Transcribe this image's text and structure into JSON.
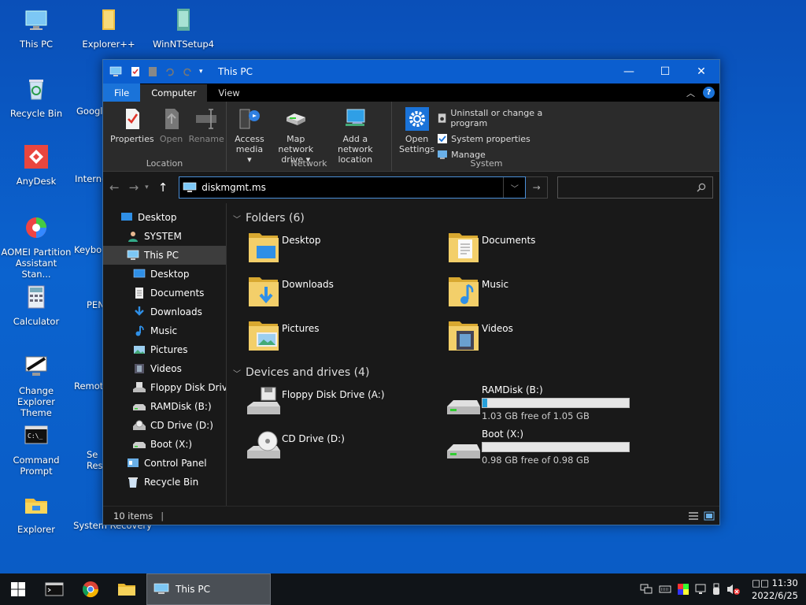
{
  "desktop": {
    "icons": [
      {
        "label": "This PC"
      },
      {
        "label": "Explorer++"
      },
      {
        "label": "WinNTSetup4"
      },
      {
        "label": "Recycle Bin"
      },
      {
        "label": "Googl"
      },
      {
        "label": "AnyDesk"
      },
      {
        "label": "Interne"
      },
      {
        "label": "AOMEI Partition Assistant Stan..."
      },
      {
        "label": "Keybo"
      },
      {
        "label": "Calculator"
      },
      {
        "label": "PEN"
      },
      {
        "label": "Change Explorer Theme"
      },
      {
        "label": "Remot"
      },
      {
        "label": "Command Prompt"
      },
      {
        "label": "Se Res"
      },
      {
        "label": "Explorer"
      },
      {
        "label": "System Recovery"
      }
    ]
  },
  "window": {
    "title": "This PC",
    "controls": {
      "minimize": "—",
      "maximize": "☐",
      "close": "✕"
    },
    "tabs": {
      "file": "File",
      "computer": "Computer",
      "view": "View"
    },
    "ribbon": {
      "location": {
        "label": "Location",
        "properties": "Properties",
        "open": "Open",
        "rename": "Rename"
      },
      "network": {
        "label": "Network",
        "access_media_1": "Access",
        "access_media_2": "media ▾",
        "map_drive_1": "Map network",
        "map_drive_2": "drive ▾",
        "add_location_1": "Add a network",
        "add_location_2": "location"
      },
      "system": {
        "label": "System",
        "open_settings_1": "Open",
        "open_settings_2": "Settings",
        "uninstall": "Uninstall or change a program",
        "system_properties": "System properties",
        "manage": "Manage"
      }
    },
    "address": {
      "value": "diskmgmt.ms"
    },
    "nav": {
      "items": [
        {
          "label": "Desktop"
        },
        {
          "label": "SYSTEM"
        },
        {
          "label": "This PC"
        },
        {
          "label": "Desktop"
        },
        {
          "label": "Documents"
        },
        {
          "label": "Downloads"
        },
        {
          "label": "Music"
        },
        {
          "label": "Pictures"
        },
        {
          "label": "Videos"
        },
        {
          "label": "Floppy Disk Drive"
        },
        {
          "label": "RAMDisk (B:)"
        },
        {
          "label": "CD Drive (D:)"
        },
        {
          "label": "Boot (X:)"
        },
        {
          "label": "Control Panel"
        },
        {
          "label": "Recycle Bin"
        }
      ]
    },
    "folders": {
      "header": "Folders (6)",
      "items": [
        {
          "label": "Desktop"
        },
        {
          "label": "Documents"
        },
        {
          "label": "Downloads"
        },
        {
          "label": "Music"
        },
        {
          "label": "Pictures"
        },
        {
          "label": "Videos"
        }
      ]
    },
    "drives": {
      "header": "Devices and drives (4)",
      "floppy": {
        "label": "Floppy Disk Drive (A:)"
      },
      "ramdisk": {
        "label": "RAMDisk (B:)",
        "free": "1.03 GB free of 1.05 GB",
        "used_fraction": 0.02
      },
      "cd": {
        "label": "CD Drive (D:)"
      },
      "boot": {
        "label": "Boot (X:)",
        "free": "0.98 GB free of 0.98 GB",
        "used_fraction": 0.0
      }
    },
    "status": {
      "count": "10 items"
    }
  },
  "taskbar": {
    "active_app": "This PC",
    "clock_time": "□□ 11:30",
    "clock_date": "2022/6/25"
  },
  "colors": {
    "accent": "#0b5ecf",
    "window_bg": "#191919",
    "ribbon_bg": "#2b2b2b",
    "drive_bar": "#26a0da"
  }
}
